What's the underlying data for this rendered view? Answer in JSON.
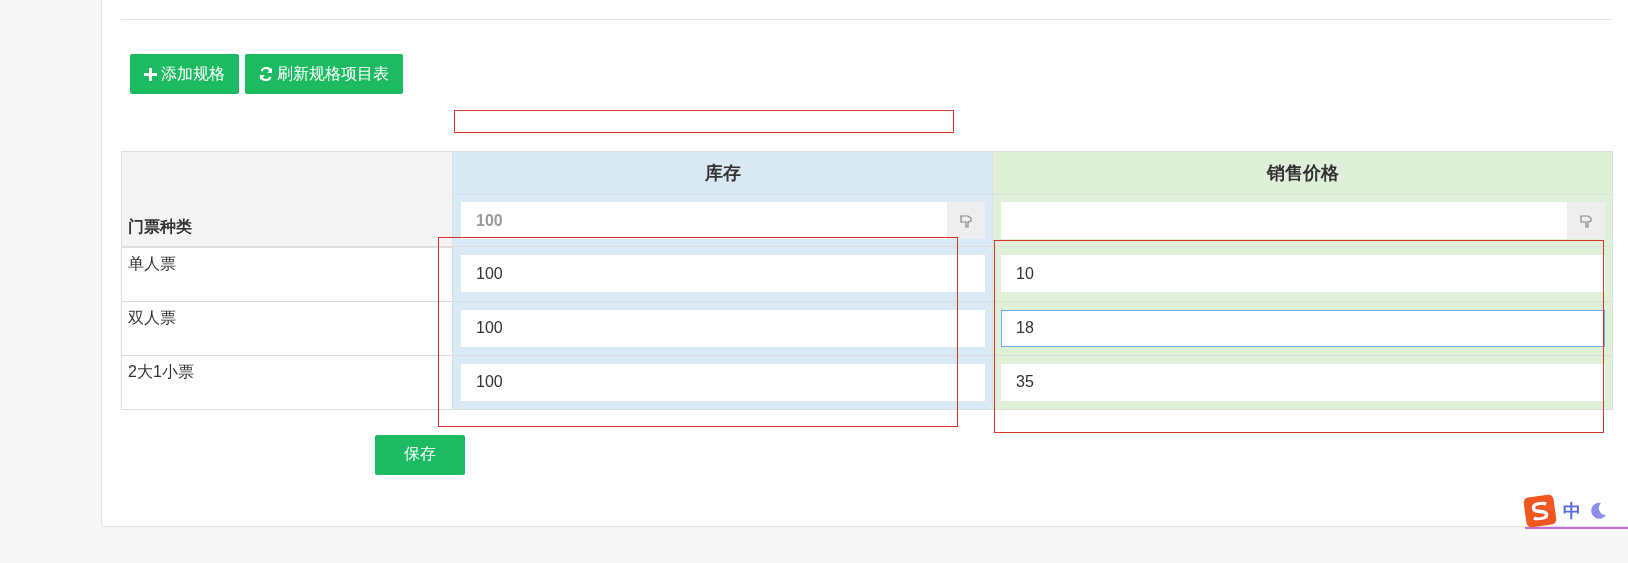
{
  "toolbar": {
    "buttons": [
      {
        "kind": "add",
        "label": "添加规格"
      },
      {
        "kind": "refresh",
        "label": "刷新规格项目表"
      }
    ]
  },
  "table": {
    "row_header": "门票种类",
    "columns": [
      {
        "title": "库存",
        "color": "#d9eaf4",
        "batch_placeholder": "100"
      },
      {
        "title": "销售价格",
        "color": "#dff0d8"
      }
    ],
    "rows": [
      {
        "label": "单人票",
        "cells": [
          {
            "value": "100",
            "focused": false
          },
          {
            "value": "10",
            "focused": false
          }
        ]
      },
      {
        "label": "双人票",
        "cells": [
          {
            "value": "100",
            "focused": false
          },
          {
            "value": "18",
            "focused": true
          }
        ]
      },
      {
        "label": "2大1小票",
        "cells": [
          {
            "value": "100",
            "focused": false
          },
          {
            "value": "35",
            "focused": false
          }
        ]
      }
    ]
  },
  "save_button": {
    "label": "保存"
  },
  "annotations": [
    {
      "kind": "box"
    },
    {
      "kind": "box"
    },
    {
      "kind": "box"
    }
  ],
  "ime_toolbar": {
    "mode": "中"
  }
}
